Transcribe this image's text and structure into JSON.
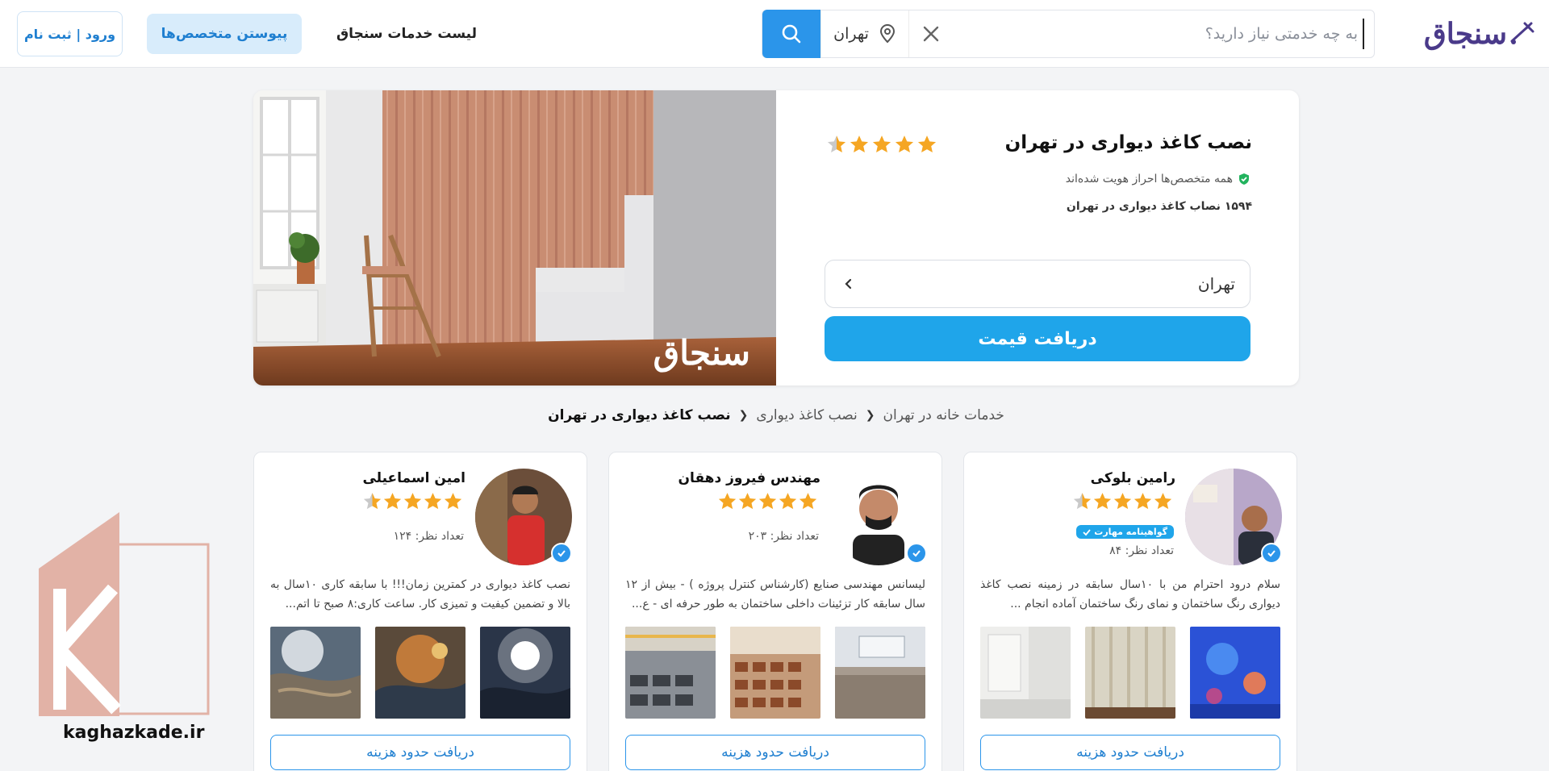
{
  "header": {
    "logo_text": "سنجاق",
    "search_placeholder": "به چه خدمتی نیاز دارید؟",
    "city": "تهران",
    "nav_services": "لیست خدمات سنجاق",
    "join_label": "پیوستن متخصص‌ها",
    "login_label": "ورود | ثبت نام"
  },
  "hero": {
    "title": "نصب کاغذ دیواری در تهران",
    "rating": 4.5,
    "verified_text": "همه متخصص‌ها احراز هویت شده‌اند",
    "count_text": "۱۵۹۴ نصاب کاغذ دیواری در تهران",
    "select_value": "تهران",
    "cta_label": "دریافت قیمت",
    "image_watermark": "سنجاق"
  },
  "breadcrumb": {
    "items": [
      "خدمات خانه در تهران",
      "نصب کاغذ دیواری",
      "نصب کاغذ دیواری در تهران"
    ]
  },
  "cards": [
    {
      "name": "رامین بلوکی",
      "rating": 4.5,
      "badge": "گواهینامه مهارت",
      "reviews": "تعداد نظر: ۸۴",
      "description": "سلام درود احترام من با ۱۰سال سابقه در زمینه نصب کاغذ دیواری رنگ ساختمان و نمای رنگ ساختمان آماده انجام ...",
      "button": "دریافت حدود هزینه"
    },
    {
      "name": "مهندس فیروز دهقان",
      "rating": 5,
      "badge": "",
      "reviews": "تعداد نظر: ۲۰۳",
      "description": "لیسانس مهندسی صنایع (کارشناس کنترل پروژه ) - بیش از ۱۲ سال سابقه کار تزئینات داخلی ساختمان به طور حرفه ای - ع...",
      "button": "دریافت حدود هزینه"
    },
    {
      "name": "امین اسماعیلی",
      "rating": 4.5,
      "badge": "",
      "reviews": "تعداد نظر: ۱۲۴",
      "description": "نصب کاغذ دیواری در کمترین زمان!!! با سابقه کاری ۱۰سال به بالا و تضمین کیفیت و تمیزی کار. ساعت کاری:۸ صبح تا اتم...",
      "button": "دریافت حدود هزینه"
    }
  ],
  "watermark": {
    "text": "kaghazkade.ir"
  },
  "colors": {
    "primary": "#1fa5ea",
    "star": "#f5a623",
    "brand": "#4a3a8a"
  }
}
